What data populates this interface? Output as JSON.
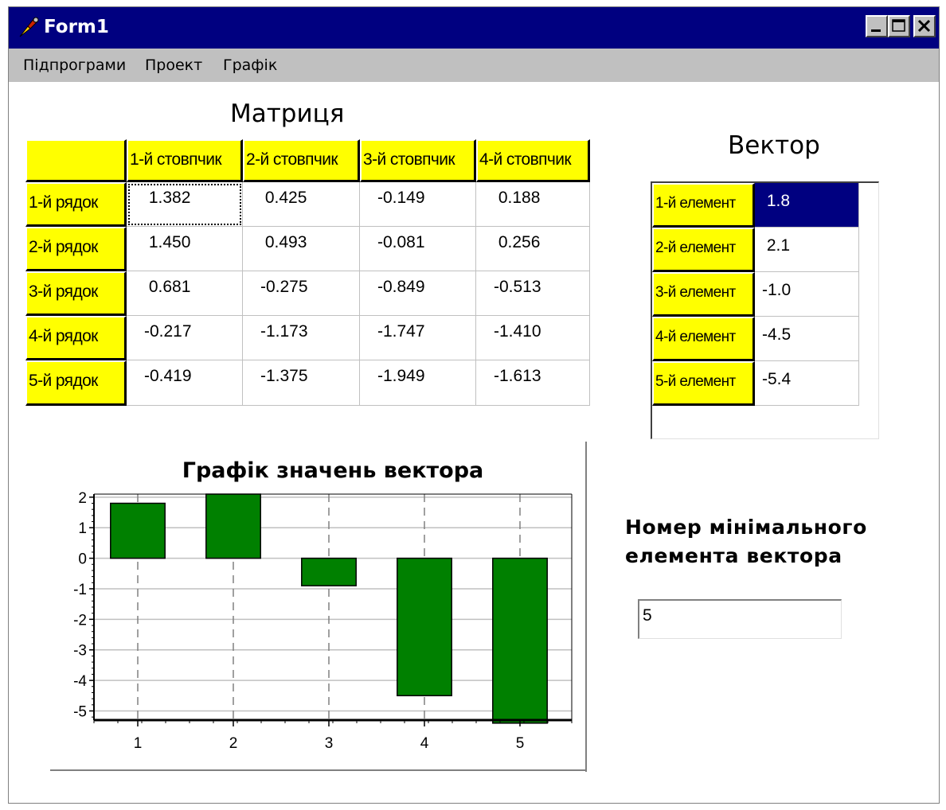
{
  "window": {
    "title": "Form1"
  },
  "menu": [
    "Підпрограми",
    "Проект",
    "Графік"
  ],
  "matrix": {
    "title": "Матриця",
    "columns": [
      "1-й стовпчик",
      "2-й стовпчик",
      "3-й стовпчик",
      "4-й стовпчик"
    ],
    "rows": [
      "1-й рядок",
      "2-й рядок",
      "3-й рядок",
      "4-й рядок",
      "5-й рядок"
    ],
    "values": [
      [
        " 1.382",
        " 0.425",
        "-0.149",
        " 0.188"
      ],
      [
        " 1.450",
        " 0.493",
        "-0.081",
        " 0.256"
      ],
      [
        " 0.681",
        "-0.275",
        "-0.849",
        "-0.513"
      ],
      [
        "-0.217",
        "-1.173",
        "-1.747",
        "-1.410"
      ],
      [
        "-0.419",
        "-1.375",
        "-1.949",
        "-1.613"
      ]
    ]
  },
  "vector": {
    "title": "Вектор",
    "labels": [
      "1-й елемент",
      "2-й елемент",
      "3-й елемент",
      "4-й елемент",
      "5-й елемент"
    ],
    "values": [
      " 1.8",
      " 2.1",
      "-1.0",
      "-4.5",
      "-5.4"
    ]
  },
  "min": {
    "label_line1": "Номер мінімального",
    "label_line2": "елемента вектора",
    "value": "5"
  },
  "colors": {
    "titlebar": "#000080",
    "fixed_cell": "#ffff00",
    "bar": "#008000",
    "window_bg": "#c0c0c0"
  },
  "chart_data": {
    "type": "bar",
    "title": "Графік значень вектора",
    "categories": [
      "1",
      "2",
      "3",
      "4",
      "5"
    ],
    "values": [
      1.8,
      2.1,
      -0.9,
      -4.5,
      -5.4
    ],
    "yticks": [
      "2",
      "1",
      "0",
      "-1",
      "-2",
      "-3",
      "-4",
      "-5"
    ],
    "ylim": [
      -5.3,
      2.1
    ],
    "grid": true
  }
}
